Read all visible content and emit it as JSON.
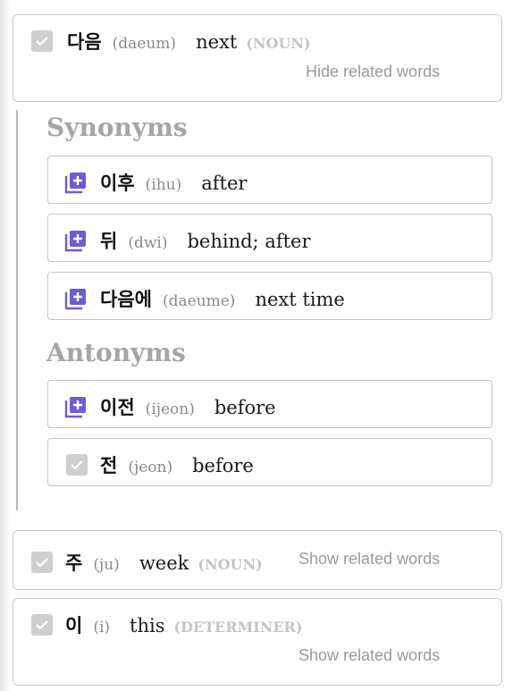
{
  "main_word": {
    "hangul": "다음",
    "roman": "(daeum)",
    "gloss": "next",
    "pos": "(NOUN)",
    "toggle": "Hide related words"
  },
  "synonyms_title": "Synonyms",
  "synonyms": [
    {
      "hangul": "이후",
      "roman": "(ihu)",
      "gloss": "after",
      "icon": "add-icon"
    },
    {
      "hangul": "뒤",
      "roman": "(dwi)",
      "gloss": "behind; after",
      "icon": "add-icon"
    },
    {
      "hangul": "다음에",
      "roman": "(daeume)",
      "gloss": "next time",
      "icon": "add-icon"
    }
  ],
  "antonyms_title": "Antonyms",
  "antonyms": [
    {
      "hangul": "이전",
      "roman": "(ijeon)",
      "gloss": "before",
      "icon": "add-icon"
    },
    {
      "hangul": "전",
      "roman": "(jeon)",
      "gloss": "before",
      "icon": "checkbox-checked"
    }
  ],
  "words": [
    {
      "hangul": "주",
      "roman": "(ju)",
      "gloss": "week",
      "pos": "(NOUN)",
      "toggle": "Show related words"
    },
    {
      "hangul": "이",
      "roman": "(i)",
      "gloss": "this",
      "pos": "(DETERMINER)",
      "toggle": "Show related words"
    }
  ],
  "colors": {
    "accent": "#6b5fd0",
    "checkbox": "#cfcfcf",
    "muted": "#a5a5a5"
  }
}
